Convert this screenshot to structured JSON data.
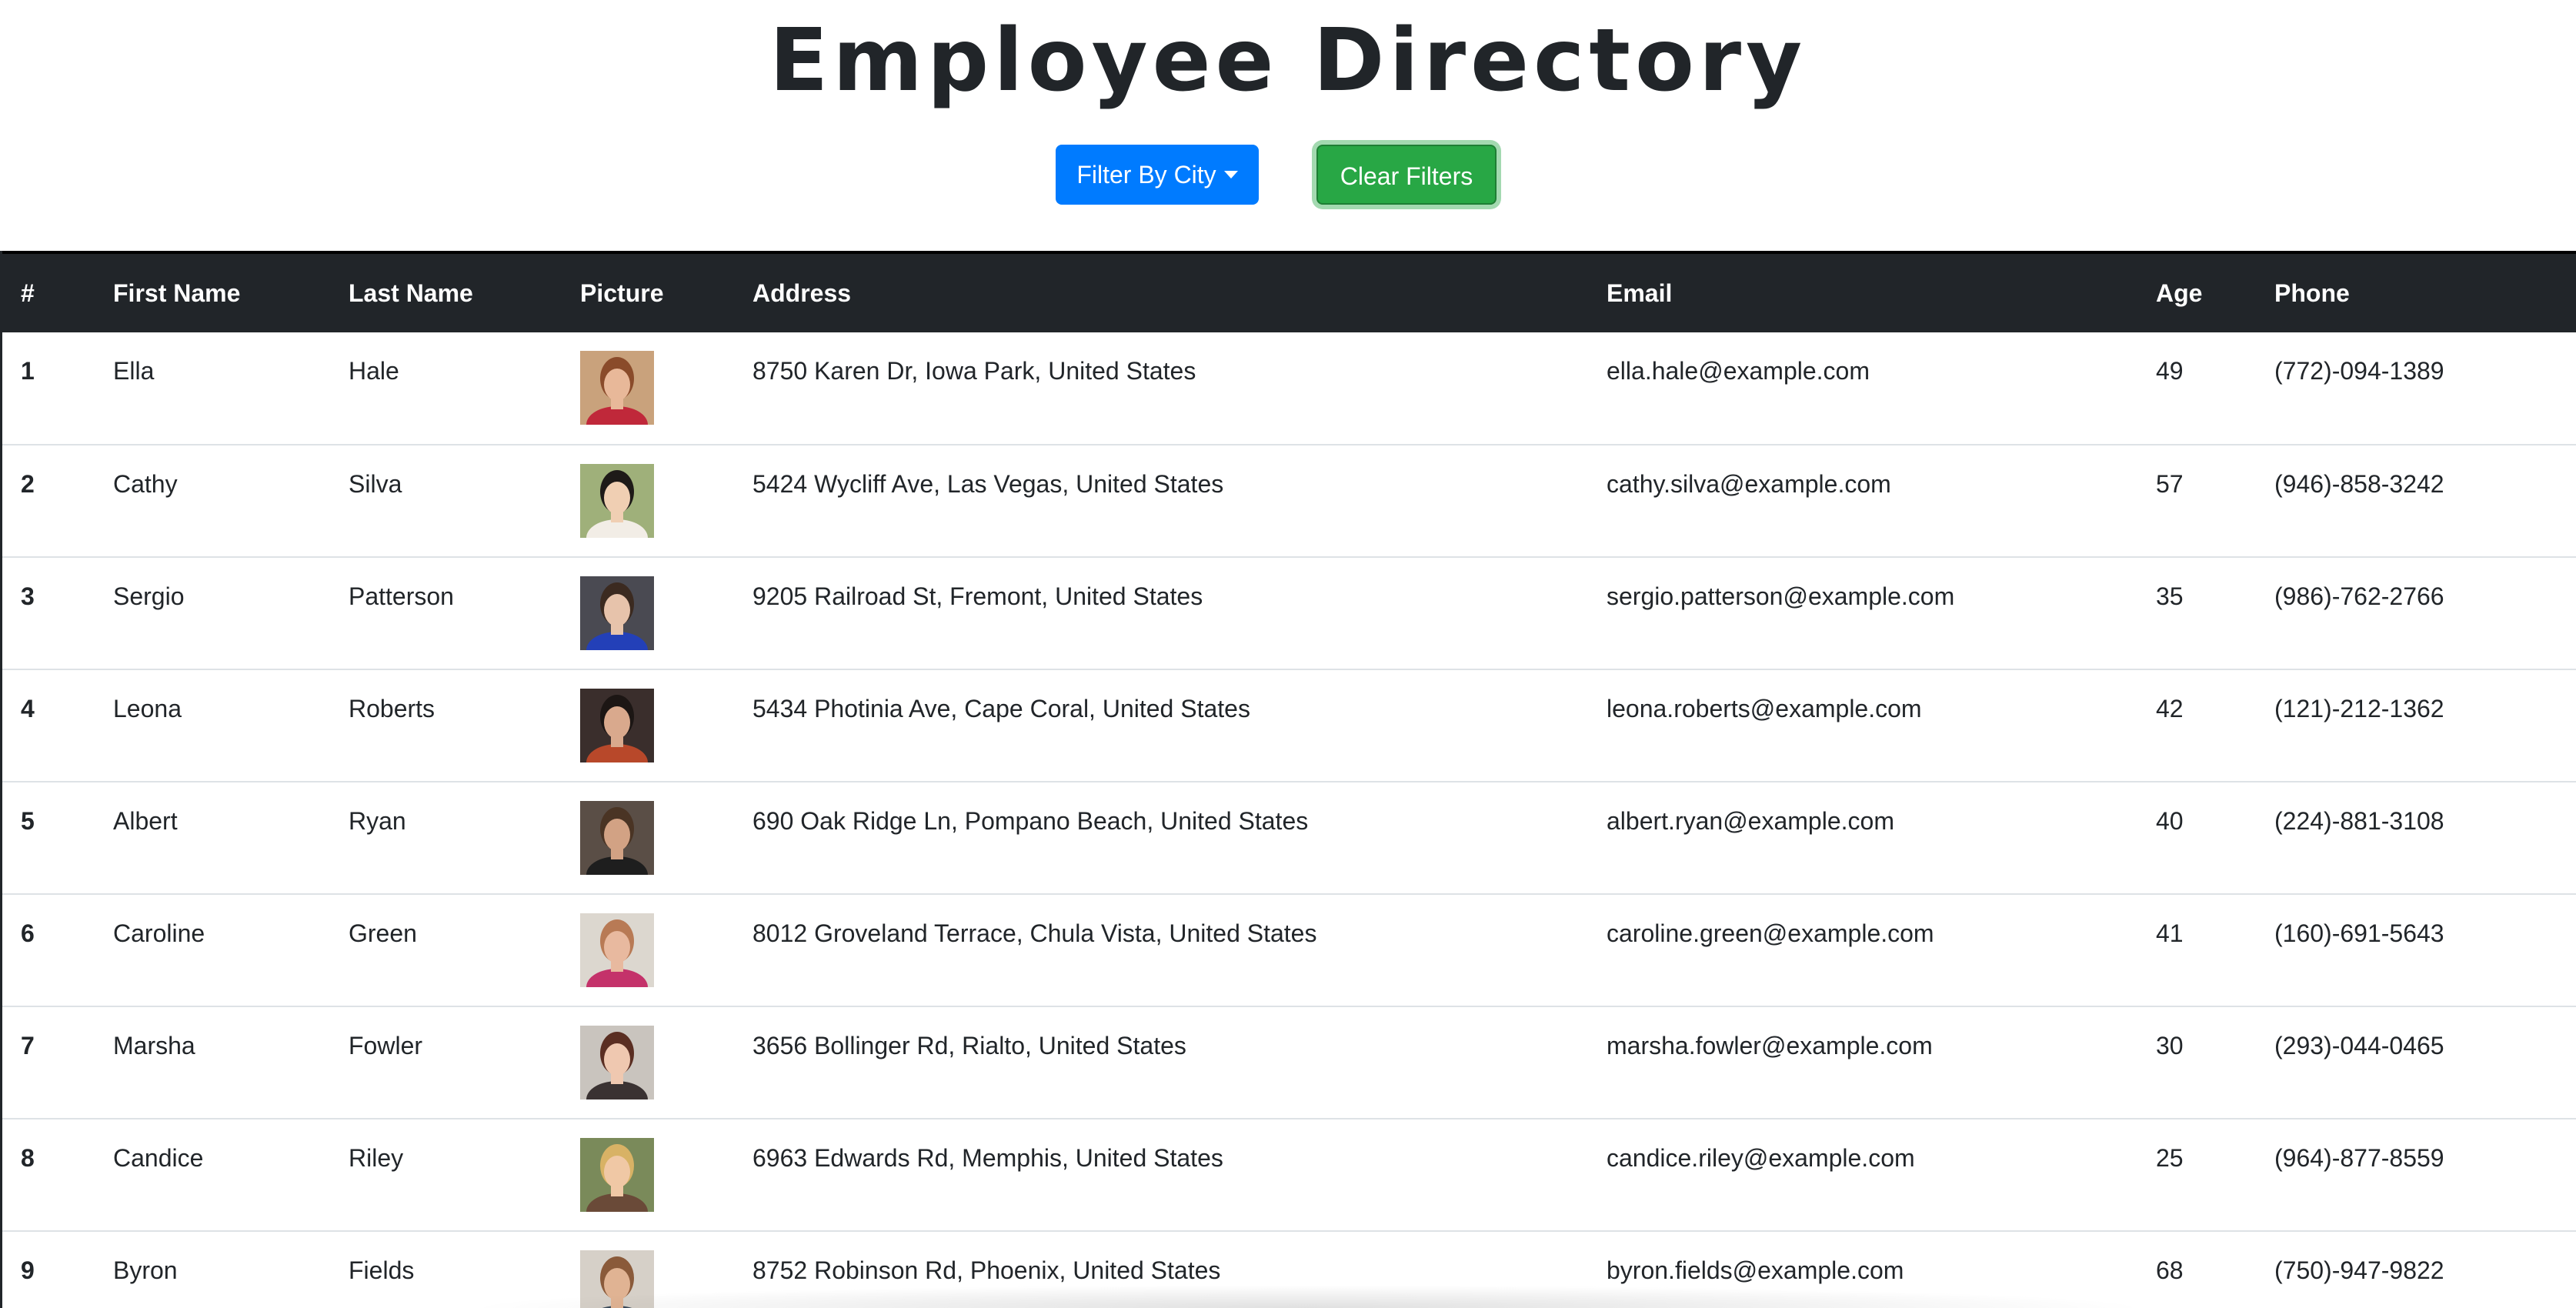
{
  "page": {
    "title": "Employee Directory"
  },
  "controls": {
    "filter_label": "Filter By City",
    "clear_label": "Clear Filters"
  },
  "colors": {
    "primary": "#007bff",
    "success": "#28a745",
    "header_bg": "#212529"
  },
  "table": {
    "headers": {
      "index": "#",
      "first_name": "First Name",
      "last_name": "Last Name",
      "picture": "Picture",
      "address": "Address",
      "email": "Email",
      "age": "Age",
      "phone": "Phone"
    },
    "rows": [
      {
        "index": "1",
        "first": "Ella",
        "last": "Hale",
        "address": "8750 Karen Dr, Iowa Park, United States",
        "email": "ella.hale@example.com",
        "age": "49",
        "phone": "(772)-094-1389"
      },
      {
        "index": "2",
        "first": "Cathy",
        "last": "Silva",
        "address": "5424 Wycliff Ave, Las Vegas, United States",
        "email": "cathy.silva@example.com",
        "age": "57",
        "phone": "(946)-858-3242"
      },
      {
        "index": "3",
        "first": "Sergio",
        "last": "Patterson",
        "address": "9205 Railroad St, Fremont, United States",
        "email": "sergio.patterson@example.com",
        "age": "35",
        "phone": "(986)-762-2766"
      },
      {
        "index": "4",
        "first": "Leona",
        "last": "Roberts",
        "address": "5434 Photinia Ave, Cape Coral, United States",
        "email": "leona.roberts@example.com",
        "age": "42",
        "phone": "(121)-212-1362"
      },
      {
        "index": "5",
        "first": "Albert",
        "last": "Ryan",
        "address": "690 Oak Ridge Ln, Pompano Beach, United States",
        "email": "albert.ryan@example.com",
        "age": "40",
        "phone": "(224)-881-3108"
      },
      {
        "index": "6",
        "first": "Caroline",
        "last": "Green",
        "address": "8012 Groveland Terrace, Chula Vista, United States",
        "email": "caroline.green@example.com",
        "age": "41",
        "phone": "(160)-691-5643"
      },
      {
        "index": "7",
        "first": "Marsha",
        "last": "Fowler",
        "address": "3656 Bollinger Rd, Rialto, United States",
        "email": "marsha.fowler@example.com",
        "age": "30",
        "phone": "(293)-044-0465"
      },
      {
        "index": "8",
        "first": "Candice",
        "last": "Riley",
        "address": "6963 Edwards Rd, Memphis, United States",
        "email": "candice.riley@example.com",
        "age": "25",
        "phone": "(964)-877-8559"
      },
      {
        "index": "9",
        "first": "Byron",
        "last": "Fields",
        "address": "8752 Robinson Rd, Phoenix, United States",
        "email": "byron.fields@example.com",
        "age": "68",
        "phone": "(750)-947-9822"
      }
    ]
  }
}
